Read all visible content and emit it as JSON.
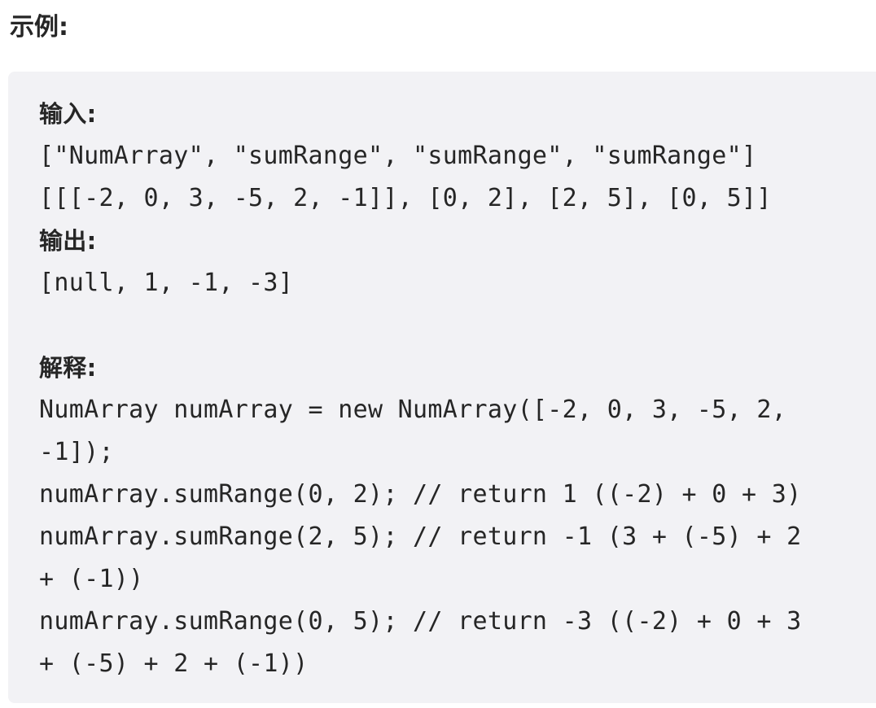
{
  "heading": "示例:",
  "example": {
    "input_label": "输入:",
    "input_line_1": "[\"NumArray\", \"sumRange\", \"sumRange\", \"sumRange\"]",
    "input_line_2": "[[[-2, 0, 3, -5, 2, -1]], [0, 2], [2, 5], [0, 5]]",
    "output_label": "输出:",
    "output_line_1": "[null, 1, -1, -3]",
    "explanation_label": "解释:",
    "explanation_lines": [
      "NumArray numArray = new NumArray([-2, 0, 3, -5, 2,",
      "-1]);",
      "numArray.sumRange(0, 2); // return 1 ((-2) + 0 + 3)",
      "numArray.sumRange(2, 5); // return -1 (3 + (-5) + 2",
      "+ (-1))",
      "numArray.sumRange(0, 5); // return -3 ((-2) + 0 + 3",
      "+ (-5) + 2 + (-1))"
    ]
  }
}
